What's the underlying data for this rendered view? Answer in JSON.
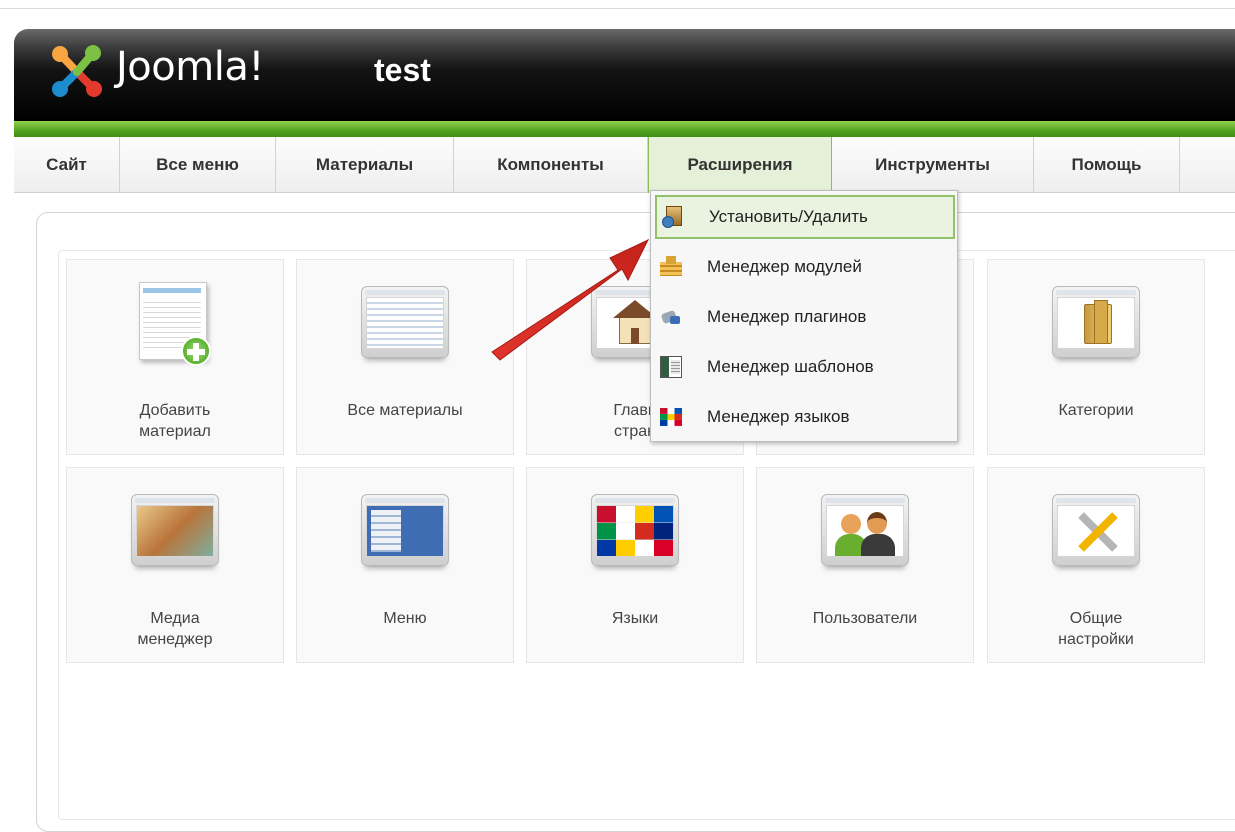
{
  "header": {
    "logo_text": "Joomla!",
    "site_name": "test"
  },
  "menu": {
    "items": [
      {
        "label": "Сайт"
      },
      {
        "label": "Все меню"
      },
      {
        "label": "Материалы"
      },
      {
        "label": "Компоненты"
      },
      {
        "label": "Расширения"
      },
      {
        "label": "Инструменты"
      },
      {
        "label": "Помощь"
      }
    ],
    "active": "Расширения"
  },
  "dropdown": {
    "items": [
      {
        "label": "Установить/Удалить",
        "icon": "install-icon",
        "highlighted": true
      },
      {
        "label": "Менеджер модулей",
        "icon": "module-icon"
      },
      {
        "label": "Менеджер плагинов",
        "icon": "plugin-icon"
      },
      {
        "label": "Менеджер шаблонов",
        "icon": "template-icon"
      },
      {
        "label": "Менеджер языков",
        "icon": "language-flags-icon"
      }
    ]
  },
  "tiles": [
    {
      "line1": "Добавить",
      "line2": "материал",
      "icon": "add-article-icon"
    },
    {
      "line1": "Все материалы",
      "line2": "",
      "icon": "articles-icon"
    },
    {
      "line1": "Главн",
      "line2": "стран",
      "icon": "home-icon"
    },
    {
      "line1": "",
      "line2": "",
      "icon": "hidden-tile-icon"
    },
    {
      "line1": "Категории",
      "line2": "",
      "icon": "category-folder-icon"
    },
    {
      "line1": "Медиа",
      "line2": "менеджер",
      "icon": "media-icon"
    },
    {
      "line1": "Меню",
      "line2": "",
      "icon": "menu-icon"
    },
    {
      "line1": "Языки",
      "line2": "",
      "icon": "languages-icon"
    },
    {
      "line1": "Пользователи",
      "line2": "",
      "icon": "users-icon"
    },
    {
      "line1": "Общие",
      "line2": "настройки",
      "icon": "settings-tools-icon"
    }
  ],
  "colors": {
    "accent_green": "#54a321",
    "header_dark": "#000000",
    "arrow_red": "#e0342b"
  }
}
